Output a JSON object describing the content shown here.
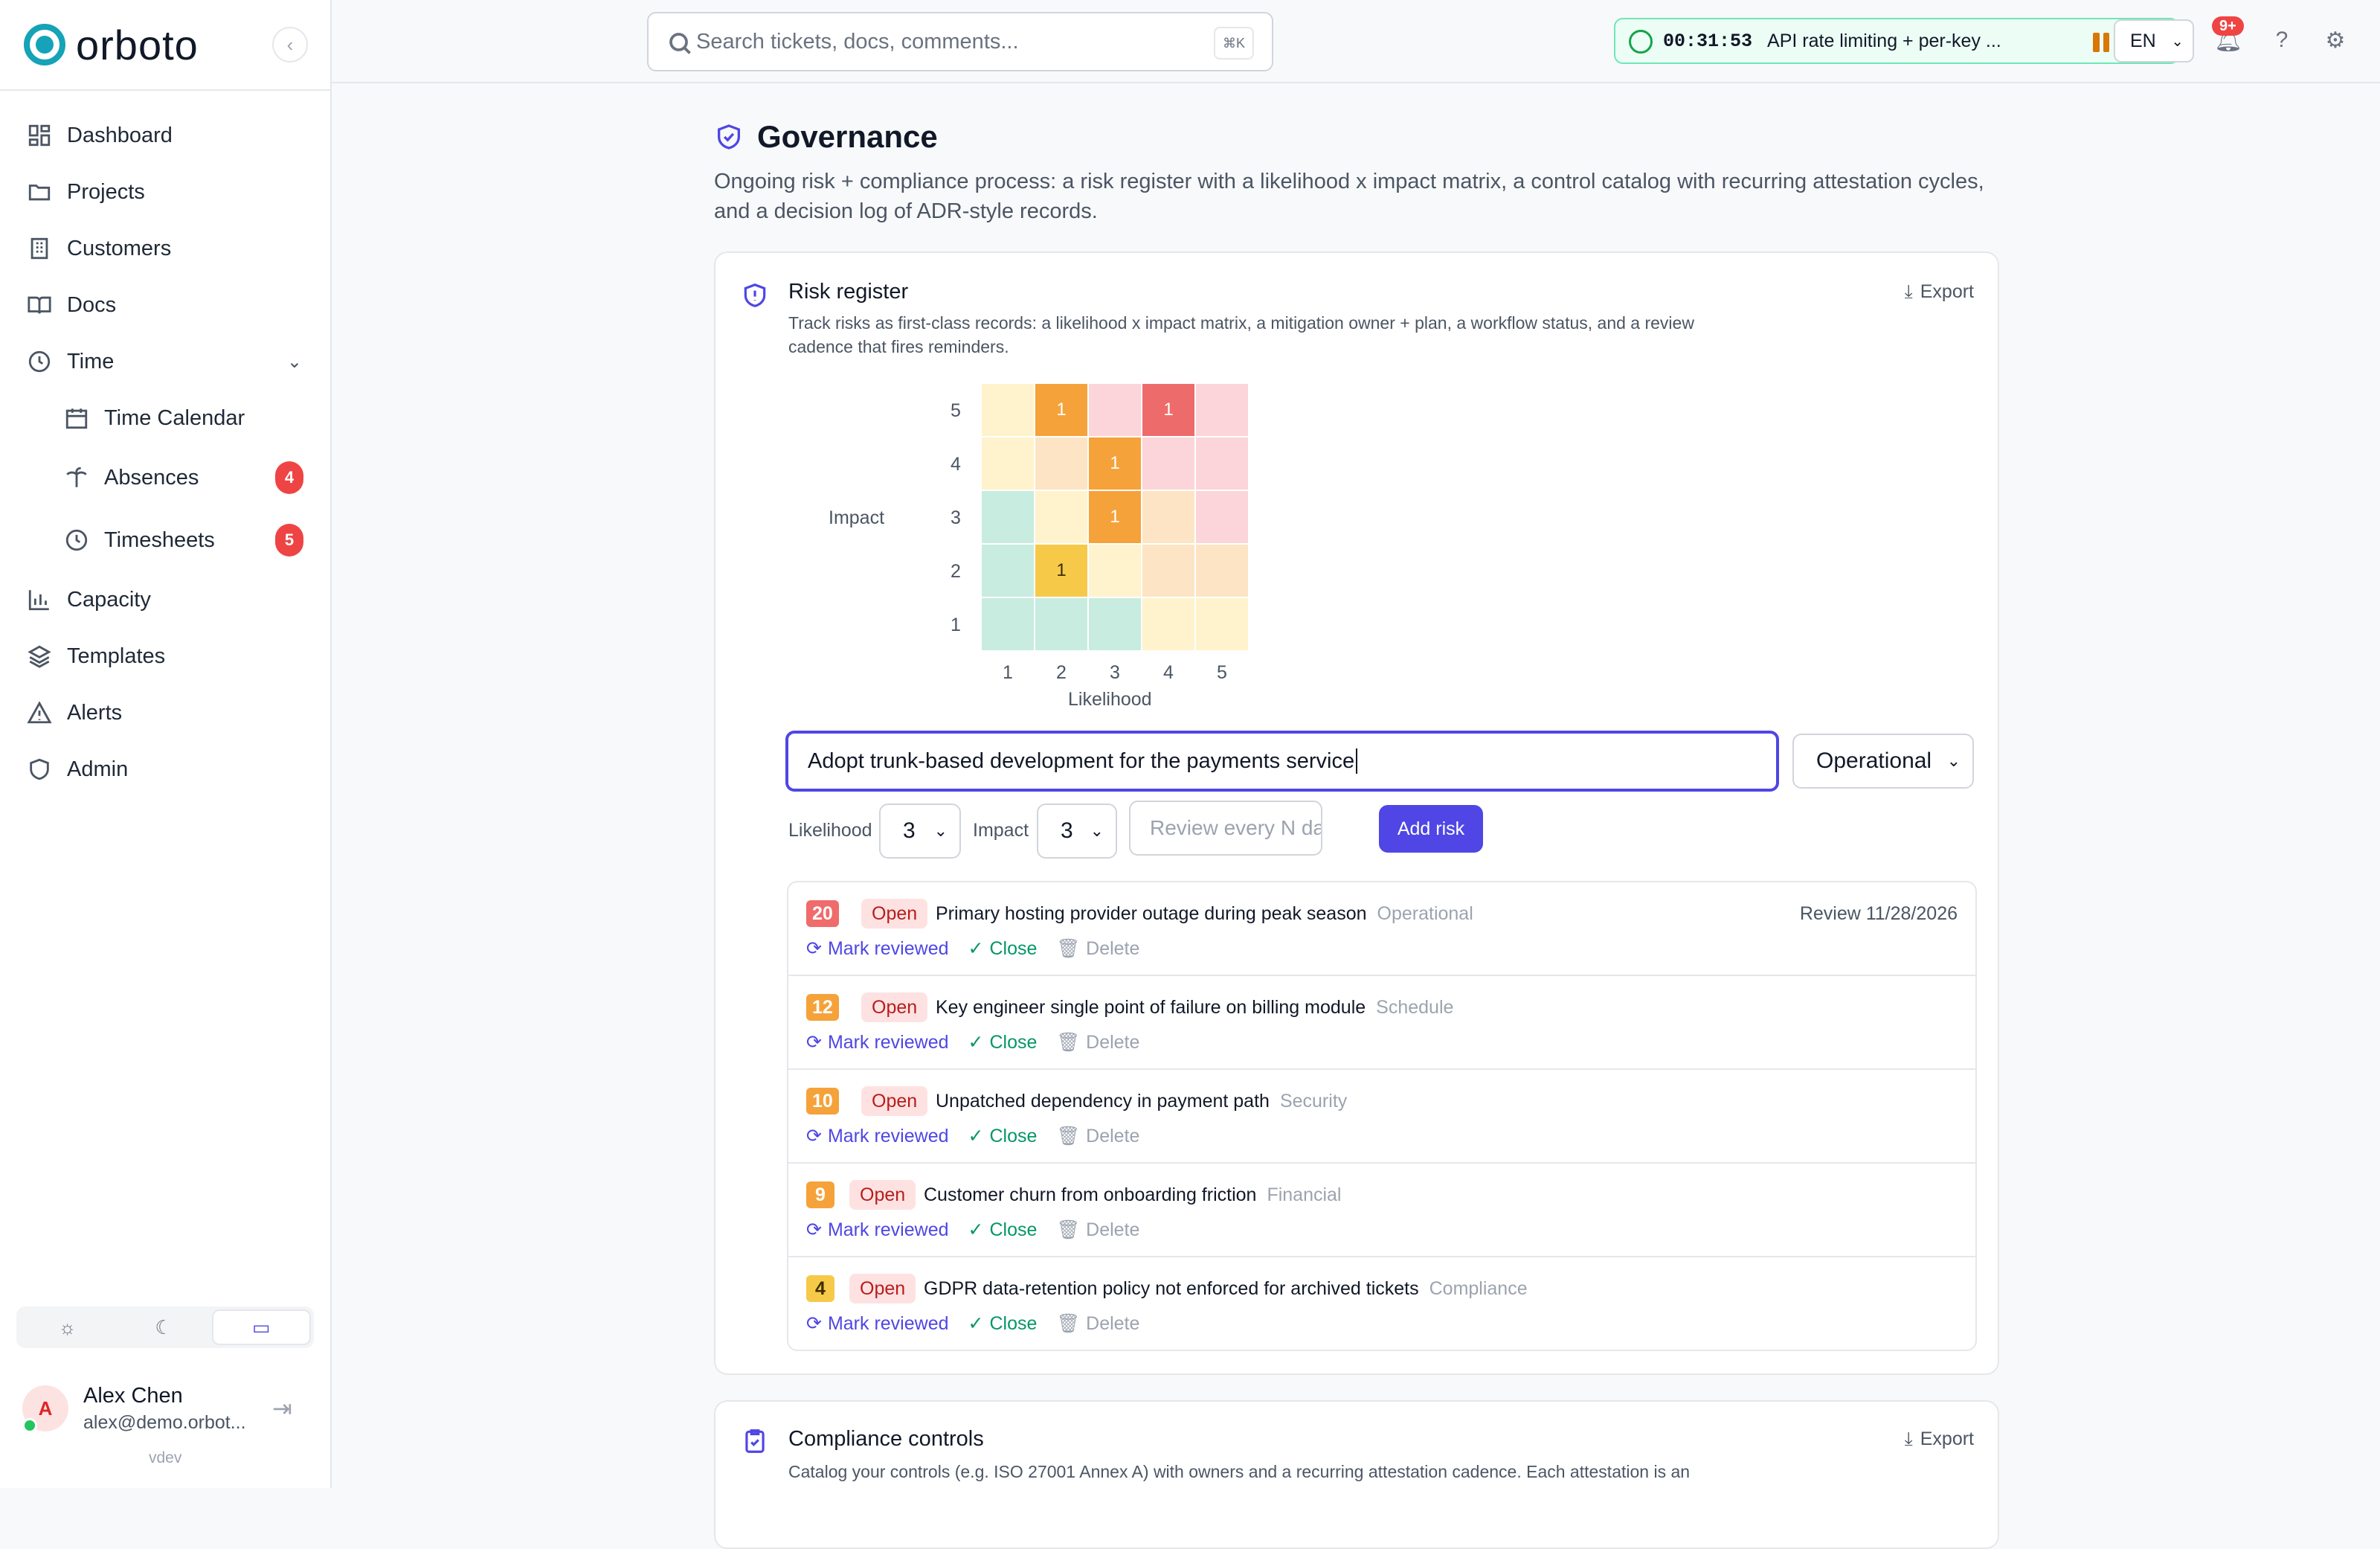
{
  "app": {
    "name": "orboto",
    "version": "vdev"
  },
  "search": {
    "placeholder": "Search tickets, docs, comments...",
    "shortcut": "⌘K"
  },
  "timer": {
    "time": "00:31:53",
    "label": "API rate limiting + per-key ..."
  },
  "lang": "EN",
  "notifications": "9+",
  "sidebar": {
    "items": [
      {
        "label": "Dashboard",
        "icon": "dashboard-icon"
      },
      {
        "label": "Projects",
        "icon": "folder-icon"
      },
      {
        "label": "Customers",
        "icon": "building-icon"
      },
      {
        "label": "Docs",
        "icon": "book-icon"
      },
      {
        "label": "Time",
        "icon": "clock-icon"
      },
      {
        "label": "Time Calendar",
        "icon": "calendar-icon"
      },
      {
        "label": "Absences",
        "icon": "palm-tree-icon",
        "badge": "4"
      },
      {
        "label": "Timesheets",
        "icon": "clock-icon",
        "badge": "5"
      },
      {
        "label": "Capacity",
        "icon": "bar-chart-icon"
      },
      {
        "label": "Templates",
        "icon": "layers-icon"
      },
      {
        "label": "Alerts",
        "icon": "alert-triangle-icon"
      },
      {
        "label": "Admin",
        "icon": "shield-icon"
      }
    ]
  },
  "user": {
    "name": "Alex Chen",
    "email": "alex@demo.orbot...",
    "initial": "A"
  },
  "page": {
    "title": "Governance",
    "description": "Ongoing risk + compliance process: a risk register with a likelihood x impact matrix, a control catalog with recurring attestation cycles, and a decision log of ADR-style records."
  },
  "risk_register": {
    "title": "Risk register",
    "description": "Track risks as first-class records: a likelihood x impact matrix, a mitigation owner + plan, a workflow status, and a review cadence that fires reminders.",
    "export": "Export",
    "matrix": {
      "x_label": "Likelihood",
      "y_label": "Impact",
      "x_ticks": [
        "1",
        "2",
        "3",
        "4",
        "5"
      ],
      "y_ticks": [
        "5",
        "4",
        "3",
        "2",
        "1"
      ],
      "counts": [
        {
          "likelihood": 2,
          "impact": 5,
          "count": "1"
        },
        {
          "likelihood": 4,
          "impact": 5,
          "count": "1"
        },
        {
          "likelihood": 3,
          "impact": 4,
          "count": "1"
        },
        {
          "likelihood": 3,
          "impact": 3,
          "count": "1"
        },
        {
          "likelihood": 2,
          "impact": 2,
          "count": "1"
        }
      ]
    },
    "form": {
      "title_value": "Adopt trunk-based development for the payments service",
      "category": "Operational",
      "likelihood_label": "Likelihood",
      "likelihood": "3",
      "impact_label": "Impact",
      "impact": "3",
      "review_placeholder": "Review every N da",
      "add_label": "Add risk"
    },
    "actions": {
      "reviewed": "Mark reviewed",
      "close": "Close",
      "delete": "Delete"
    },
    "risks": [
      {
        "score": "20",
        "status": "Open",
        "title": "Primary hosting provider outage during peak season",
        "category": "Operational",
        "review": "Review 11/28/2026",
        "color": "#f06b6b"
      },
      {
        "score": "12",
        "status": "Open",
        "title": "Key engineer single point of failure on billing module",
        "category": "Schedule",
        "review": "",
        "color": "#f5a23a"
      },
      {
        "score": "10",
        "status": "Open",
        "title": "Unpatched dependency in payment path",
        "category": "Security",
        "review": "",
        "color": "#f5a23a"
      },
      {
        "score": "9",
        "status": "Open",
        "title": "Customer churn from onboarding friction",
        "category": "Financial",
        "review": "",
        "color": "#f5a23a"
      },
      {
        "score": "4",
        "status": "Open",
        "title": "GDPR data-retention policy not enforced for archived tickets",
        "category": "Compliance",
        "review": "",
        "color": "#f7c948"
      }
    ]
  },
  "compliance": {
    "title": "Compliance controls",
    "description": "Catalog your controls (e.g. ISO 27001 Annex A) with owners and a recurring attestation cadence. Each attestation is an",
    "export": "Export"
  },
  "colors": {
    "accent": "#4f46e5",
    "brand": "#14a3b8"
  }
}
